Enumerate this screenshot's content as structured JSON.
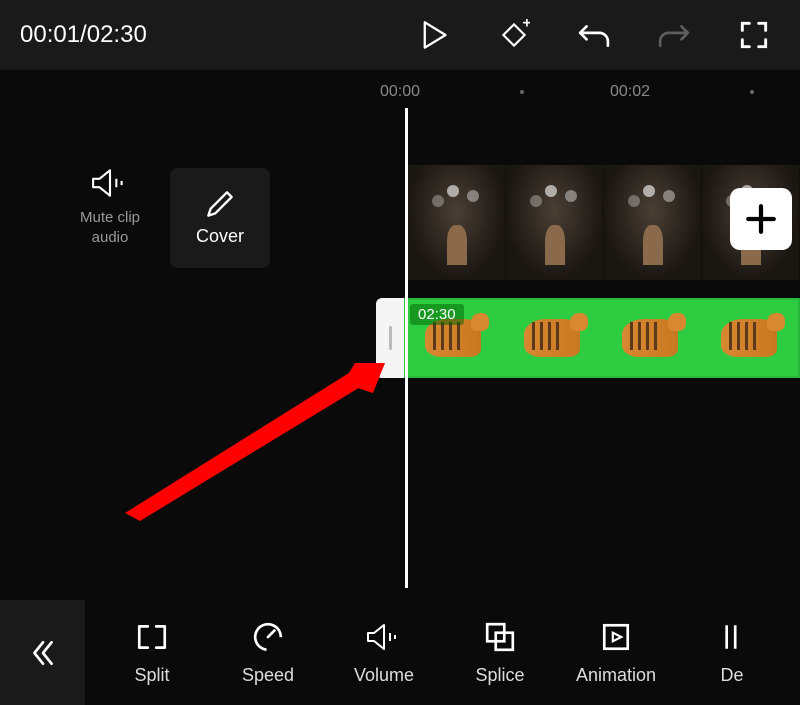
{
  "header": {
    "current_time": "00:01",
    "total_time": "02:30",
    "timecode_display": "00:01/02:30"
  },
  "ruler": {
    "marks": [
      "00:00",
      "00:02"
    ]
  },
  "left_panel": {
    "mute_label_line1": "Mute clip",
    "mute_label_line2": "audio",
    "cover_label": "Cover"
  },
  "track": {
    "green_clip_duration": "02:30"
  },
  "toolbar": {
    "items": [
      {
        "label": "Split"
      },
      {
        "label": "Speed"
      },
      {
        "label": "Volume"
      },
      {
        "label": "Splice"
      },
      {
        "label": "Animation"
      },
      {
        "label": "De"
      }
    ]
  }
}
